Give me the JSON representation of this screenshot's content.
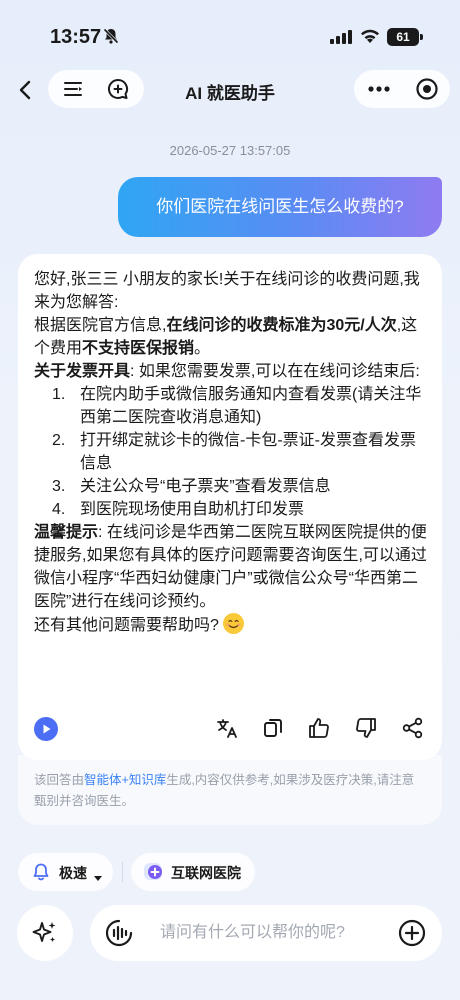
{
  "status_bar": {
    "time": "13:57",
    "battery": "61"
  },
  "nav": {
    "title": "AI 就医助手"
  },
  "timestamp": "2026-05-27 13:57:05",
  "user_message": "你们医院在线问医生怎么收费的?",
  "answer": {
    "greeting": "您好,张三三 小朋友的家长!关于在线问诊的收费问题,我来为您解答:",
    "fee_prefix": "根据医院官方信息,",
    "fee_bold": "在线问诊的收费标准为30元/人次",
    "fee_mid": ",这个费用",
    "fee_bold2": "不支持医保报销",
    "fee_suffix": "。",
    "invoice_label": "关于发票开具",
    "invoice_text": ": 如果您需要发票,可以在在线问诊结束后:",
    "steps": [
      {
        "num": "1.",
        "text": "在院内助手或微信服务通知内查看发票(请关注华西第二医院查收消息通知)"
      },
      {
        "num": "2.",
        "text": "打开绑定就诊卡的微信-卡包-票证-发票查看发票信息"
      },
      {
        "num": "3.",
        "text": "关注公众号“电子票夹”查看发票信息"
      },
      {
        "num": "4.",
        "text": "到医院现场使用自助机打印发票"
      }
    ],
    "tip_label": "温馨提示",
    "tip_text": ": 在线问诊是华西第二医院互联网医院提供的便捷服务,如果您有具体的医疗问题需要咨询医生,可以通过微信小程序“华西妇幼健康门户”或微信公众号“华西第二医院”进行在线问诊预约。",
    "closing": "还有其他问题需要帮助吗?"
  },
  "disclaimer": {
    "prefix": "该回答由",
    "highlight": "智能体+知识库",
    "suffix": "生成,内容仅供参考,如果涉及医疗决策,请注意甄别并咨询医生。"
  },
  "chips": {
    "speed": "极速",
    "hospital": "互联网医院"
  },
  "input": {
    "placeholder": "请问有什么可以帮你的呢?"
  },
  "colors": {
    "accent": "#4c6ef5",
    "link": "#3b82f6"
  }
}
